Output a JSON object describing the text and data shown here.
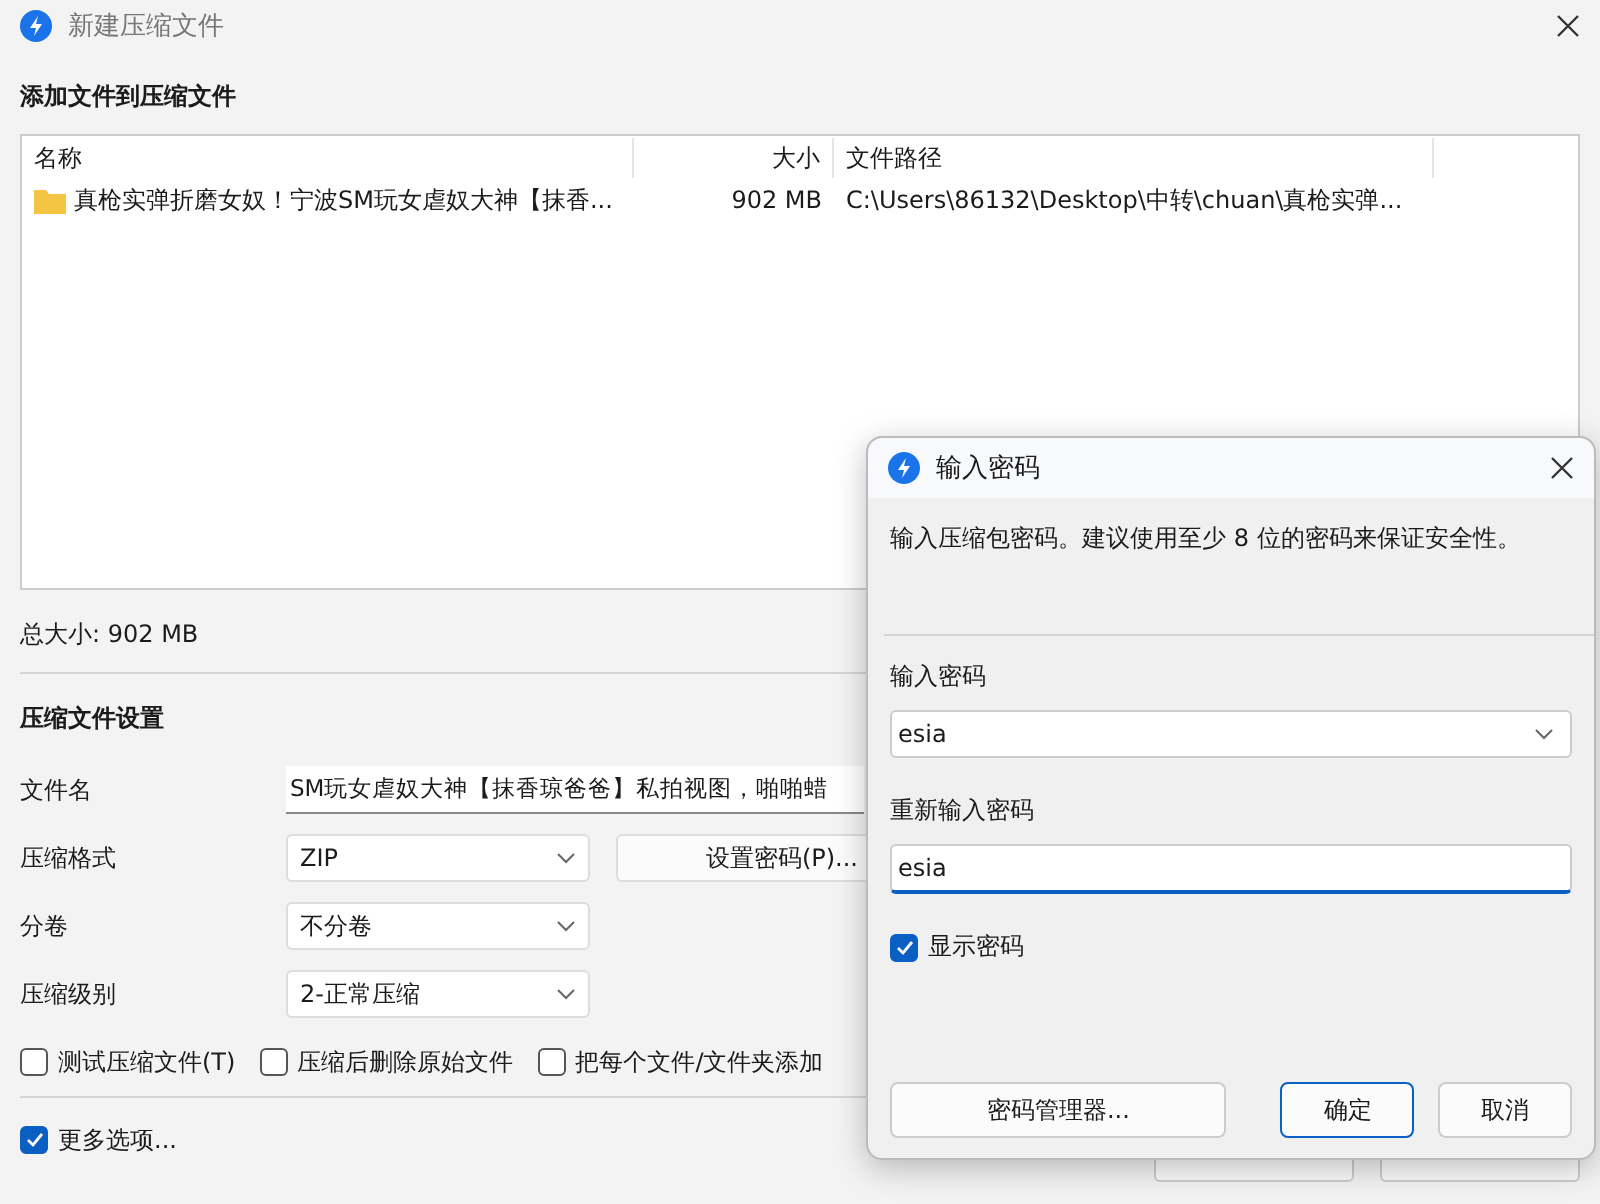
{
  "window": {
    "title": "新建压缩文件"
  },
  "files": {
    "heading": "添加文件到压缩文件",
    "columns": [
      "名称",
      "大小",
      "文件路径"
    ],
    "rows": [
      {
        "name": "真枪实弹折磨女奴！宁波SM玩女虐奴大神【抹香...",
        "size": "902 MB",
        "path": "C:\\Users\\86132\\Desktop\\中转\\chuan\\真枪实弹..."
      }
    ],
    "total": "总大小: 902 MB"
  },
  "settings": {
    "heading": "压缩文件设置",
    "fields": [
      {
        "kind": "text",
        "label": "文件名",
        "value": "SM玩女虐奴大神【抹香琼爸爸】私拍视图，啪啪蜡"
      },
      {
        "kind": "select",
        "label": "压缩格式",
        "value": "ZIP"
      },
      {
        "kind": "select",
        "label": "分卷",
        "value": "不分卷"
      },
      {
        "kind": "select",
        "label": "压缩级别",
        "value": "2-正常压缩"
      }
    ],
    "password_button": "设置密码(P)...",
    "options": [
      {
        "label": "测试压缩文件(T)",
        "checked": false
      },
      {
        "label": "压缩后删除原始文件",
        "checked": false
      },
      {
        "label": "把每个文件/文件夹添加",
        "checked": false
      }
    ],
    "more_options": {
      "label": "更多选项...",
      "checked": true
    }
  },
  "password_dialog": {
    "title": "输入密码",
    "description": "输入压缩包密码。建议使用至少 8 位的密码来保证安全性。",
    "password_label": "输入密码",
    "password_value": "esia",
    "confirm_label": "重新输入密码",
    "confirm_value": "esia",
    "show_password": {
      "label": "显示密码",
      "checked": true
    },
    "buttons": [
      {
        "label": "密码管理器...",
        "focused": false
      },
      {
        "label": "确定",
        "focused": true
      },
      {
        "label": "取消",
        "focused": false
      }
    ]
  }
}
